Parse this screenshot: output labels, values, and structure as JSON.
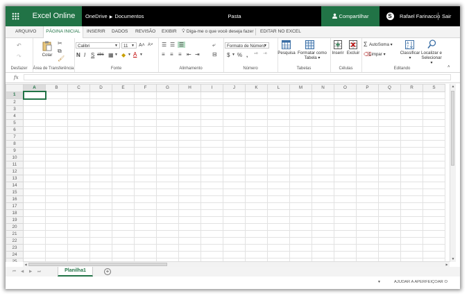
{
  "app": {
    "brand": "Excel Online",
    "breadcrumb": [
      "OneDrive",
      "Documentos"
    ],
    "document_title": "Pasta",
    "share_label": "Compartilhar",
    "skype_label": "S",
    "user_name": "Rafael Farinaccio",
    "signout_label": "Sair"
  },
  "tabs": [
    "ARQUIVO",
    "PÁGINA INICIAL",
    "INSERIR",
    "DADOS",
    "REVISÃO",
    "EXIBIR"
  ],
  "active_tab": "PÁGINA INICIAL",
  "tell_me": "Diga-me o que você deseja fazer",
  "edit_in_excel": "EDITAR NO EXCEL",
  "ribbon": {
    "undo_group": "Desfazer",
    "clipboard": {
      "paste": "Colar",
      "group": "Área de Transferência"
    },
    "font": {
      "name": "Calibri",
      "size": "11",
      "group": "Fonte",
      "grow": "A˄",
      "shrink": "A˅",
      "bold": "N",
      "italic": "I",
      "underline": "S",
      "strike": "abc"
    },
    "alignment": {
      "group": "Alinhamento"
    },
    "number": {
      "format": "Formato de Número",
      "currency": "$",
      "percent": "%",
      "thousands": ",",
      "group": "Número"
    },
    "tables": {
      "table": "Pesquisa",
      "format_as_table": "Formatar como",
      "format_as_table_2": "Tabela",
      "group": "Tabelas"
    },
    "cells": {
      "insert": "Inserir",
      "delete": "Excluir",
      "group": "Células"
    },
    "editing": {
      "autosum": "AutoSoma",
      "clear": "Limpar",
      "sort": "Classificar",
      "find": "Localizar e",
      "find_2": "Selecionar",
      "group": "Editando"
    }
  },
  "formula_bar": {
    "fx": "fx",
    "value": ""
  },
  "grid": {
    "columns": [
      "A",
      "B",
      "C",
      "D",
      "E",
      "F",
      "G",
      "H",
      "I",
      "J",
      "K",
      "L",
      "M",
      "N",
      "O",
      "P",
      "Q",
      "R",
      "S"
    ],
    "rows": [
      "1",
      "2",
      "3",
      "4",
      "5",
      "6",
      "7",
      "8",
      "9",
      "10",
      "11",
      "12",
      "13",
      "14",
      "15",
      "16",
      "17",
      "18",
      "19",
      "20",
      "21",
      "22",
      "23",
      "24",
      "25"
    ],
    "selected_cell": "A1"
  },
  "sheets": [
    "Planilha1"
  ],
  "status": {
    "feedback": "AJUDAR A APERFEIÇOAR O OFFICE"
  },
  "colors": {
    "accent": "#217346",
    "topbar": "#000000"
  }
}
